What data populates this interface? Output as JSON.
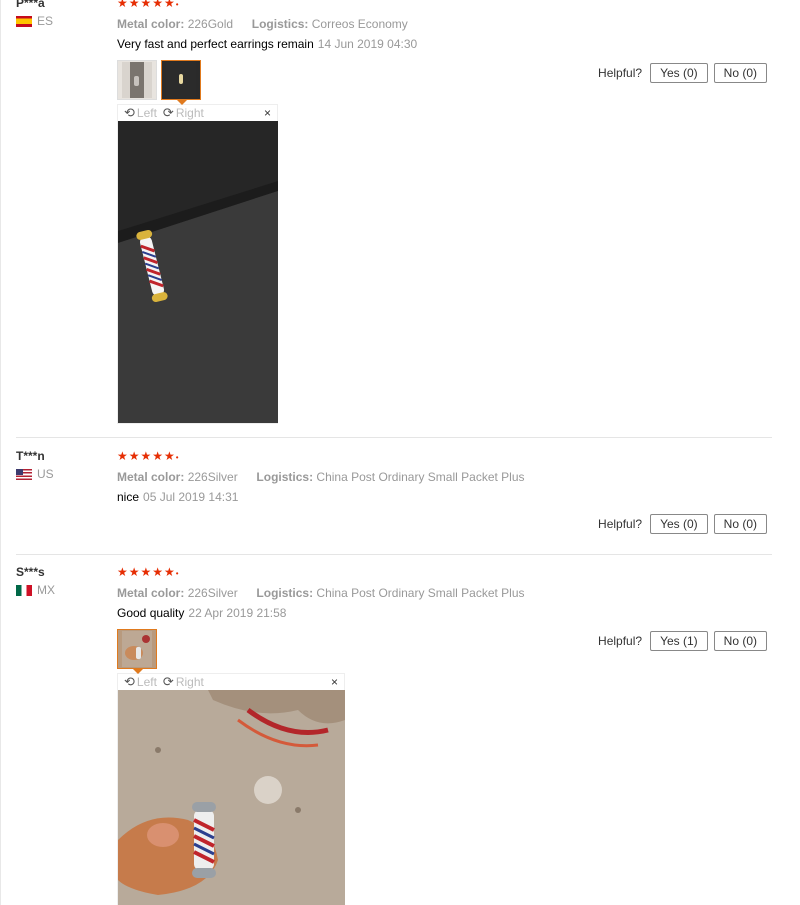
{
  "reviews": [
    {
      "user": "P***a",
      "country": "ES",
      "stars": "★★★★★",
      "metal_label": "Metal color:",
      "metal_value": "226Gold",
      "logistics_label": "Logistics:",
      "logistics_value": "Correos Economy",
      "text": "Very fast and perfect earrings remain",
      "date": "14 Jun 2019 04:30",
      "helpful_label": "Helpful?",
      "yes_label": "Yes (0)",
      "no_label": "No (0)",
      "viewer": {
        "left_label": "Left",
        "right_label": "Right",
        "close": "×"
      }
    },
    {
      "user": "T***n",
      "country": "US",
      "stars": "★★★★★",
      "metal_label": "Metal color:",
      "metal_value": "226Silver",
      "logistics_label": "Logistics:",
      "logistics_value": "China Post Ordinary Small Packet Plus",
      "text": "nice",
      "date": "05 Jul 2019 14:31",
      "helpful_label": "Helpful?",
      "yes_label": "Yes (0)",
      "no_label": "No (0)"
    },
    {
      "user": "S***s",
      "country": "MX",
      "stars": "★★★★★",
      "metal_label": "Metal color:",
      "metal_value": "226Silver",
      "logistics_label": "Logistics:",
      "logistics_value": "China Post Ordinary Small Packet Plus",
      "text": "Good quality",
      "date": "22 Apr 2019 21:58",
      "helpful_label": "Helpful?",
      "yes_label": "Yes (1)",
      "no_label": "No (0)",
      "viewer": {
        "left_label": "Left",
        "right_label": "Right",
        "close": "×"
      }
    }
  ],
  "colors": {
    "star": "#e62e04",
    "thumb_active_border": "#e07a1e",
    "muted_text": "#999999"
  },
  "icons": {
    "rotate_left": "rotate-left-icon",
    "rotate_right": "rotate-right-icon",
    "close": "close-icon"
  }
}
